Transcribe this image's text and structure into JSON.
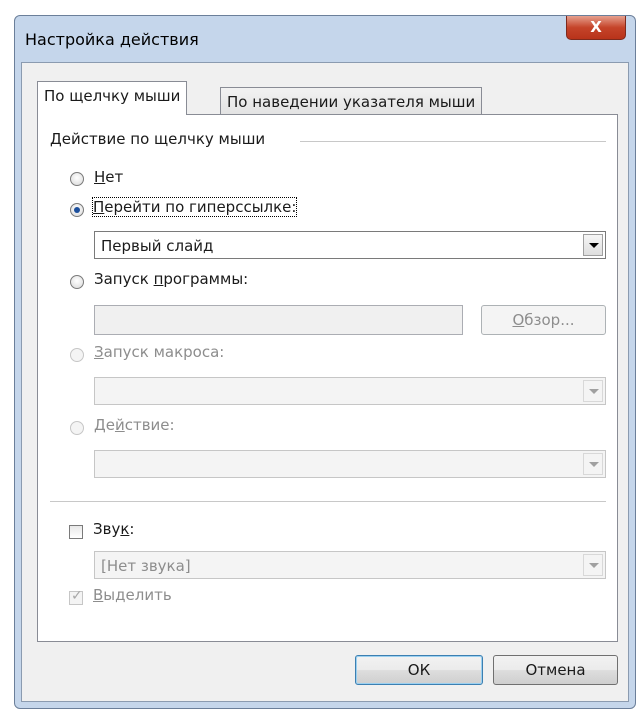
{
  "window": {
    "title": "Настройка действия",
    "close_glyph": "X"
  },
  "tabs": [
    {
      "label": "По щелчку мыши",
      "active": true
    },
    {
      "label": "По наведении указателя мыши",
      "active": false
    }
  ],
  "group": {
    "label": "Действие по щелчку мыши"
  },
  "options": {
    "none": {
      "prefix": "",
      "accel": "Н",
      "rest": "ет",
      "selected": false,
      "enabled": true
    },
    "hyperlink": {
      "prefix": "",
      "accel": "П",
      "rest": "ерейти по гиперссылке:",
      "selected": true,
      "enabled": true
    },
    "run_program": {
      "prefix": "Запуск ",
      "accel": "п",
      "rest": "рограммы:",
      "selected": false,
      "enabled": true
    },
    "run_macro": {
      "prefix": "",
      "accel": "З",
      "rest": "апуск макроса:",
      "selected": false,
      "enabled": false
    },
    "object_action": {
      "prefix": "Де",
      "accel": "й",
      "rest": "ствие:",
      "selected": false,
      "enabled": false
    }
  },
  "hyperlink_select": {
    "value": "Первый слайд"
  },
  "program_input": {
    "value": ""
  },
  "browse_button": {
    "prefix": "",
    "accel": "О",
    "rest": "бзор..."
  },
  "macro_select": {
    "value": ""
  },
  "action_select": {
    "value": ""
  },
  "sound": {
    "prefix": "Зву",
    "accel": "к",
    "rest": ":",
    "checked": false
  },
  "sound_select": {
    "value": "[Нет звука]"
  },
  "highlight": {
    "prefix": "",
    "accel": "В",
    "rest": "ыделить",
    "checked": true,
    "enabled": false,
    "check_glyph": "✓"
  },
  "buttons": {
    "ok": "ОК",
    "cancel": "Отмена"
  },
  "colors": {
    "accent": "#1c4f9c",
    "close": "#c5442a",
    "disabled_text": "#8d8d8d"
  },
  "icons": [
    "close-icon",
    "chevron-down-icon",
    "checkmark-icon"
  ]
}
